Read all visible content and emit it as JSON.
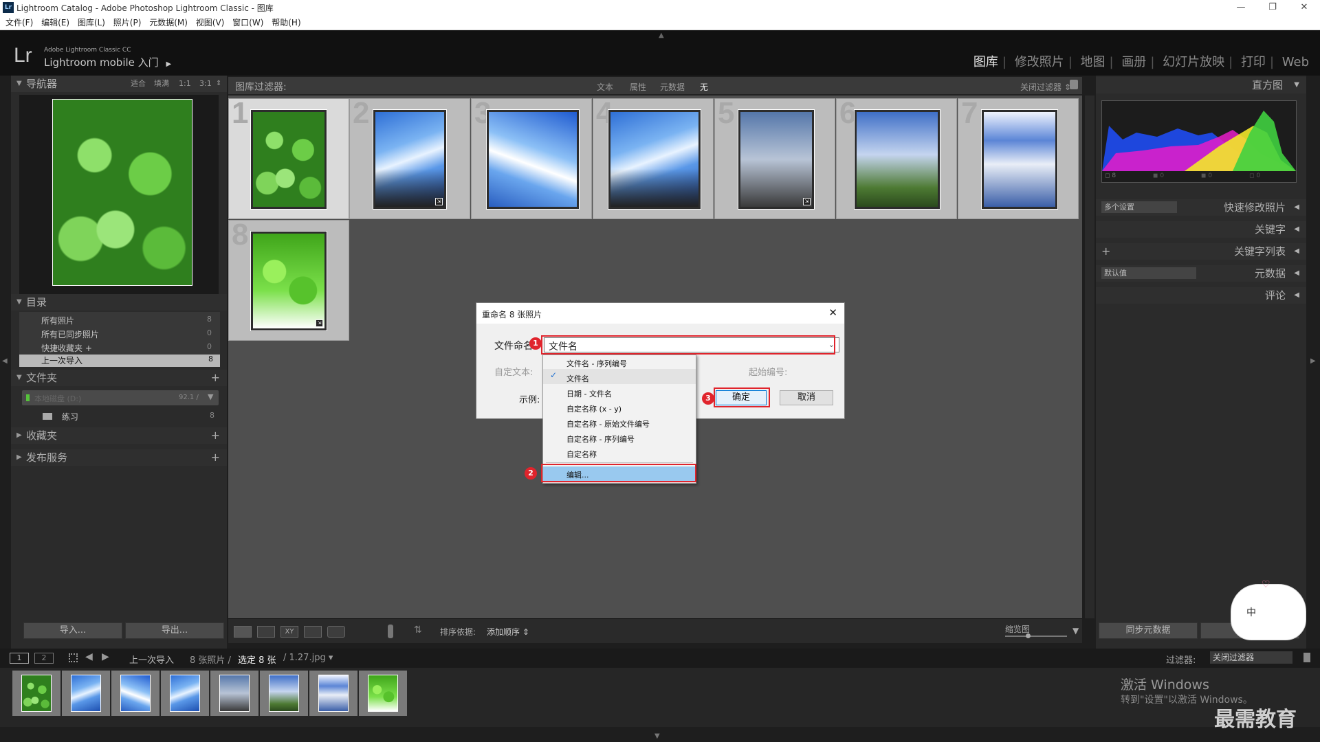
{
  "window": {
    "title": "Lightroom Catalog - Adobe Photoshop Lightroom Classic - 图库",
    "badge": "Lr",
    "controls": [
      "—",
      "❐",
      "✕"
    ]
  },
  "menu": [
    "文件(F)",
    "编辑(E)",
    "图库(L)",
    "照片(P)",
    "元数据(M)",
    "视图(V)",
    "窗口(W)",
    "帮助(H)"
  ],
  "identity": {
    "logo": "Lr",
    "product_small": "Adobe Lightroom Classic CC",
    "product_line": "Lightroom mobile 入门",
    "arrow": "▶"
  },
  "modules": [
    "图库",
    "修改照片",
    "地图",
    "画册",
    "幻灯片放映",
    "打印",
    "Web"
  ],
  "module_sep": "|",
  "navigator": {
    "title": "导航器",
    "zoom_options": [
      "适合",
      "填满",
      "1:1",
      "3:1"
    ],
    "zoom_arrow": "⇕"
  },
  "catalog": {
    "title": "目录",
    "items": [
      {
        "label": "所有照片",
        "count": "8"
      },
      {
        "label": "所有已同步照片",
        "count": "0"
      },
      {
        "label": "快捷收藏夹 +",
        "count": "0"
      },
      {
        "label": "上一次导入",
        "count": "8"
      }
    ]
  },
  "folders": {
    "title": "文件夹",
    "plus": "+",
    "volume": {
      "name": "本地磁盘 (D:)",
      "size": "92.1 / ",
      "arrow": "▼"
    },
    "items": [
      {
        "label": "练习",
        "count": "8"
      }
    ]
  },
  "collections": {
    "title": "收藏夹",
    "plus": "+"
  },
  "publish": {
    "title": "发布服务",
    "plus": "+"
  },
  "left_buttons": {
    "import": "导入...",
    "export": "导出..."
  },
  "filter_bar": {
    "label": "图库过滤器:",
    "options": [
      "文本",
      "属性",
      "元数据",
      "无"
    ],
    "close": "关闭过滤器 ⇕"
  },
  "grid": [
    {
      "n": "1",
      "selected": true,
      "img": "clover"
    },
    {
      "n": "2",
      "selected": false,
      "img": "sky"
    },
    {
      "n": "3",
      "selected": false,
      "img": "sky2"
    },
    {
      "n": "4",
      "selected": false,
      "img": "sky"
    },
    {
      "n": "5",
      "selected": false,
      "img": "pole"
    },
    {
      "n": "6",
      "selected": false,
      "img": "pole2"
    },
    {
      "n": "7",
      "selected": false,
      "img": "clouds"
    },
    {
      "n": "8",
      "selected": false,
      "img": "leaves"
    }
  ],
  "histogram": {
    "title": "直方图",
    "info": [
      "8",
      "0",
      "0",
      "0"
    ]
  },
  "right_panels": {
    "quick_develop": {
      "title": "快速修改照片",
      "preset": "多个设置"
    },
    "keywording": {
      "title": "关键字"
    },
    "keyword_list": {
      "title": "关键字列表",
      "plus": "+"
    },
    "metadata": {
      "title": "元数据",
      "preset": "默认值"
    },
    "comments": {
      "title": "评论"
    }
  },
  "right_buttons": {
    "sync_metadata": "同步元数据",
    "sync_settings": "同"
  },
  "toolbar": {
    "sort_label": "排序依据:",
    "sort_value": "添加顺序 ⇕",
    "thumb_label": "缩览图",
    "xy": "XY"
  },
  "filmstrip_header": {
    "screen1": "1",
    "screen2": "2",
    "source": "上一次导入",
    "photo_count": "8 张照片 /",
    "selected": "选定 8 张",
    "file": "/ 1.27.jpg ▾",
    "filter_label": "过滤器:",
    "filter_value": "关闭过滤器"
  },
  "filmstrip": [
    "clover",
    "sky",
    "sky2",
    "sky",
    "pole",
    "pole2",
    "clouds",
    "leaves"
  ],
  "dialog": {
    "title": "重命名 8 张照片",
    "close": "✕",
    "naming_label": "文件命名:",
    "naming_value": "文件名",
    "custom_text_label": "自定文本:",
    "start_number_label": "起始编号:",
    "example_label": "示例:",
    "ok": "确定",
    "cancel": "取消"
  },
  "dropdown_options": [
    {
      "label": "文件名 - 序列编号",
      "checked": false
    },
    {
      "label": "文件名",
      "checked": true
    },
    {
      "label": "日期 - 文件名",
      "checked": false
    },
    {
      "label": "自定名称 (x - y)",
      "checked": false
    },
    {
      "label": "自定名称 - 原始文件编号",
      "checked": false
    },
    {
      "label": "自定名称 - 序列编号",
      "checked": false
    },
    {
      "label": "自定名称",
      "checked": false
    }
  ],
  "dropdown_edit": "编辑...",
  "markers": [
    "1",
    "2",
    "3"
  ],
  "watermark": {
    "activate_title": "激活 Windows",
    "activate_sub": "转到\"设置\"以激活 Windows。",
    "brand": "最需教育",
    "ime": "中"
  },
  "colors": {
    "accent_red": "#e0242c",
    "selection_blue": "#99c9ef"
  }
}
